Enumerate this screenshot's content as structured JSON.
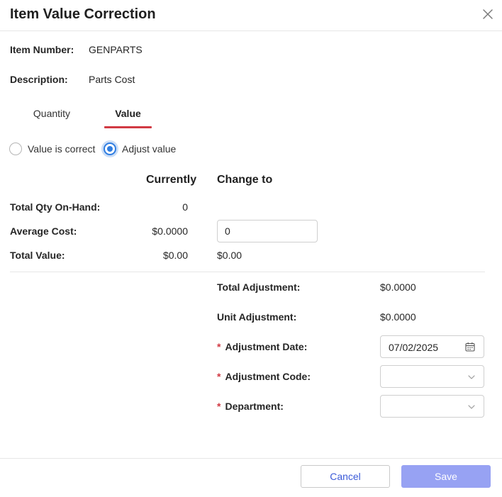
{
  "dialog": {
    "title": "Item Value Correction"
  },
  "item": {
    "number_label": "Item Number:",
    "number_value": "GENPARTS",
    "description_label": "Description:",
    "description_value": "Parts Cost"
  },
  "tabs": [
    {
      "label": "Quantity",
      "active": false
    },
    {
      "label": "Value",
      "active": true
    }
  ],
  "radio": {
    "correct_label": "Value is correct",
    "adjust_label": "Adjust value",
    "selected": "adjust"
  },
  "columns": {
    "currently": "Currently",
    "change_to": "Change to"
  },
  "rows": {
    "total_qty_label": "Total Qty On-Hand:",
    "total_qty_current": "0",
    "avg_cost_label": "Average Cost:",
    "avg_cost_current": "$0.0000",
    "avg_cost_change": "0",
    "total_value_label": "Total Value:",
    "total_value_current": "$0.00",
    "total_value_change": "$0.00"
  },
  "adjustment": {
    "total_label": "Total Adjustment:",
    "total_value": "$0.0000",
    "unit_label": "Unit Adjustment:",
    "unit_value": "$0.0000",
    "date_label": "Adjustment Date:",
    "date_value": "07/02/2025",
    "code_label": "Adjustment Code:",
    "code_value": "",
    "department_label": "Department:",
    "department_value": "",
    "required_marker": "*"
  },
  "buttons": {
    "cancel": "Cancel",
    "save": "Save"
  },
  "colors": {
    "accent_red": "#d13a44",
    "radio_blue": "#2f7de1",
    "save_bg": "#97a2f3",
    "cancel_text": "#3c5bd8"
  },
  "icons": [
    "close-icon",
    "calendar-icon",
    "chevron-down-icon"
  ]
}
